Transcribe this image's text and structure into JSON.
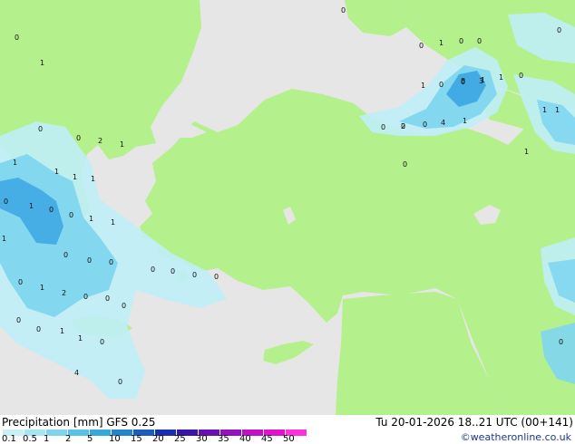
{
  "footer": {
    "title_left": "Precipitation [mm] GFS 0.25",
    "title_right": "Tu 20-01-2026 18..21 UTC (00+141)",
    "credit": "©weatheronline.co.uk"
  },
  "legend": {
    "ticks": [
      "0.1",
      "0.5",
      "1",
      "2",
      "5",
      "10",
      "15",
      "20",
      "25",
      "30",
      "35",
      "40",
      "45",
      "50"
    ],
    "colors": [
      "#c8f0f5",
      "#a6e6f2",
      "#7ed4ec",
      "#58c2e6",
      "#34a8dc",
      "#1f86cc",
      "#1a5cc0",
      "#1830b0",
      "#3a14a8",
      "#6a10b0",
      "#9410c0",
      "#c010c8",
      "#e010d0",
      "#ff30e0"
    ]
  },
  "map_colors": {
    "sea": "#e6e6e6",
    "land": "#b4f08c",
    "precip_light": "#bfeef7",
    "precip_mid": "#7fd6ef",
    "precip_heavy": "#3fa9e3"
  },
  "map_labels": [
    "0",
    "0",
    "1",
    "0",
    "0",
    "1",
    "0",
    "0",
    "1",
    "8",
    "3",
    "1",
    "0",
    "1",
    "1",
    "1",
    "0",
    "0",
    "2",
    "0",
    "4",
    "1",
    "0",
    "0",
    "0",
    "1",
    "0",
    "0",
    "2",
    "1",
    "1",
    "1",
    "1",
    "1",
    "0",
    "1",
    "0",
    "0",
    "1",
    "1",
    "1",
    "0",
    "0",
    "0",
    "2",
    "0",
    "0",
    "1",
    "0",
    "0",
    "0",
    "1",
    "1",
    "0",
    "0",
    "0",
    "0",
    "0",
    "0",
    "0",
    "4",
    "0"
  ]
}
